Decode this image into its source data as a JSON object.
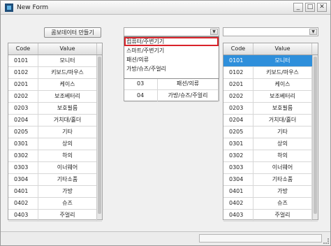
{
  "window": {
    "title": "New Form",
    "minimize": "_",
    "maximize": "□",
    "close": "✕"
  },
  "toolbar": {
    "combo_button_label": "콤보데이터 만들기"
  },
  "left_grid": {
    "headers": [
      "Code",
      "Value"
    ],
    "rows": [
      [
        "0101",
        "모니터"
      ],
      [
        "0102",
        "키보드/마우스"
      ],
      [
        "0201",
        "케이스"
      ],
      [
        "0202",
        "보조베터리"
      ],
      [
        "0203",
        "보호필름"
      ],
      [
        "0204",
        "거치대/홀더"
      ],
      [
        "0205",
        "기타"
      ],
      [
        "0301",
        "상의"
      ],
      [
        "0302",
        "하의"
      ],
      [
        "0303",
        "이너웨어"
      ],
      [
        "0304",
        "기타소품"
      ],
      [
        "0401",
        "가방"
      ],
      [
        "0402",
        "슈즈"
      ],
      [
        "0403",
        "주얼리"
      ]
    ]
  },
  "middle": {
    "combo_value": "",
    "dropdown_items": [
      "컴퓨터/주변기기",
      "스마트/주변기기",
      "패션/의류",
      "가방/슈즈/주얼리"
    ],
    "rows": [
      [
        "03",
        "패션/의류"
      ],
      [
        "04",
        "가방/슈즈/주얼리"
      ]
    ]
  },
  "right": {
    "combo_value": "",
    "headers": [
      "Code",
      "Value"
    ],
    "rows": [
      [
        "0101",
        "모니터"
      ],
      [
        "0102",
        "키보드/마우스"
      ],
      [
        "0201",
        "케이스"
      ],
      [
        "0202",
        "보조베터리"
      ],
      [
        "0203",
        "보호필름"
      ],
      [
        "0204",
        "거치대/홀더"
      ],
      [
        "0205",
        "기타"
      ],
      [
        "0301",
        "상의"
      ],
      [
        "0302",
        "하의"
      ],
      [
        "0303",
        "이너웨어"
      ],
      [
        "0304",
        "기타소품"
      ],
      [
        "0401",
        "가방"
      ],
      [
        "0402",
        "슈즈"
      ],
      [
        "0403",
        "주얼리"
      ]
    ],
    "selected_index": 0
  },
  "icons": {
    "dropdown_arrow": "▼",
    "app": "form-app-icon"
  },
  "colors": {
    "selection": "#2e8fdb",
    "highlight_border": "#d9232a"
  }
}
